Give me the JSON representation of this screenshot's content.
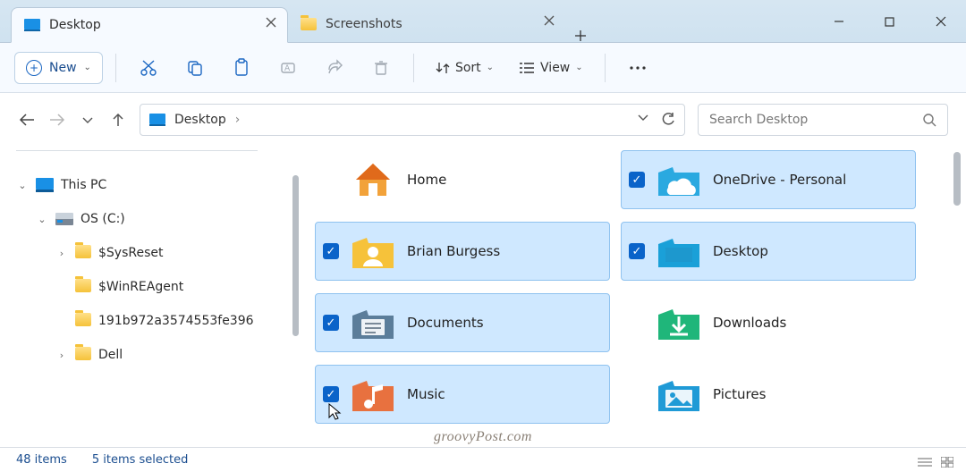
{
  "window": {
    "minimize_tip": "Minimize",
    "maximize_tip": "Maximize",
    "close_tip": "Close"
  },
  "tabs": [
    {
      "label": "Desktop",
      "active": true,
      "icon": "desktop"
    },
    {
      "label": "Screenshots",
      "active": false,
      "icon": "folder"
    }
  ],
  "tab_add_tip": "New tab",
  "toolbar": {
    "new_label": "New",
    "sort_label": "Sort",
    "view_label": "View"
  },
  "nav": {
    "back_tip": "Back",
    "forward_tip": "Forward",
    "recent_tip": "Recent locations",
    "up_tip": "Up",
    "refresh_tip": "Refresh"
  },
  "breadcrumb": {
    "segments": [
      "Desktop"
    ],
    "icon": "desktop"
  },
  "search": {
    "placeholder": "Search Desktop"
  },
  "tree": [
    {
      "depth": 0,
      "label": "This PC",
      "icon": "thispc",
      "twisty": "down"
    },
    {
      "depth": 1,
      "label": "OS (C:)",
      "icon": "drive",
      "twisty": "down"
    },
    {
      "depth": 2,
      "label": "$SysReset",
      "icon": "folder",
      "twisty": "right"
    },
    {
      "depth": 2,
      "label": "$WinREAgent",
      "icon": "folder",
      "twisty": ""
    },
    {
      "depth": 2,
      "label": "191b972a3574553fe396",
      "icon": "folder",
      "twisty": ""
    },
    {
      "depth": 2,
      "label": "Dell",
      "icon": "folder",
      "twisty": "right"
    }
  ],
  "items": [
    {
      "label": "Home",
      "icon": "home",
      "selected": false
    },
    {
      "label": "OneDrive - Personal",
      "icon": "onedrive",
      "selected": true
    },
    {
      "label": "Brian Burgess",
      "icon": "user",
      "selected": true
    },
    {
      "label": "Desktop",
      "icon": "desktop-f",
      "selected": true
    },
    {
      "label": "Documents",
      "icon": "documents",
      "selected": true
    },
    {
      "label": "Downloads",
      "icon": "downloads",
      "selected": false
    },
    {
      "label": "Music",
      "icon": "music",
      "selected": true
    },
    {
      "label": "Pictures",
      "icon": "pictures",
      "selected": false
    }
  ],
  "cursor": {
    "target_index": 6
  },
  "status": {
    "item_count_label": "48 items",
    "selected_count_label": "5 items selected"
  },
  "watermark": "groovyPost.com"
}
